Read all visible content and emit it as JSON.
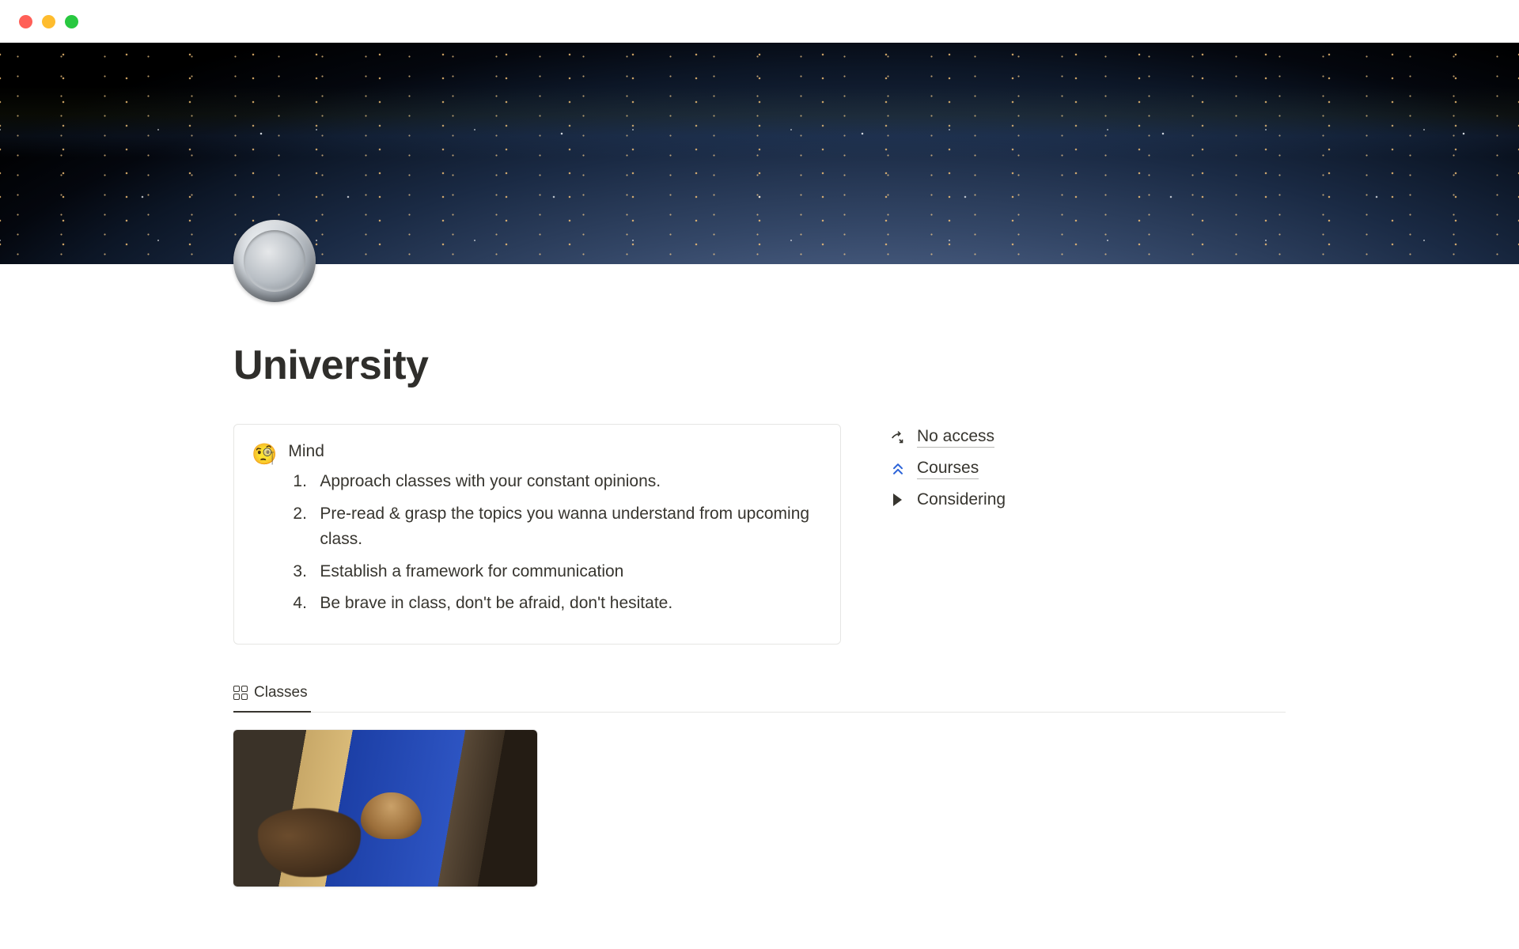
{
  "page": {
    "title": "University"
  },
  "callout": {
    "emoji": "🧐",
    "heading": "Mind",
    "items": [
      "Approach classes with your constant opinions.",
      "Pre-read & grasp the topics you wanna understand from upcoming class.",
      "Establish a framework for communication",
      "Be brave in class, don't be afraid, don't hesitate."
    ]
  },
  "sideLinks": {
    "noAccess": {
      "label": "No access",
      "icon": "share-arrow"
    },
    "courses": {
      "label": "Courses",
      "icon": "double-chevron-up"
    },
    "considering": {
      "label": "Considering"
    }
  },
  "views": {
    "classes": {
      "label": "Classes"
    }
  }
}
